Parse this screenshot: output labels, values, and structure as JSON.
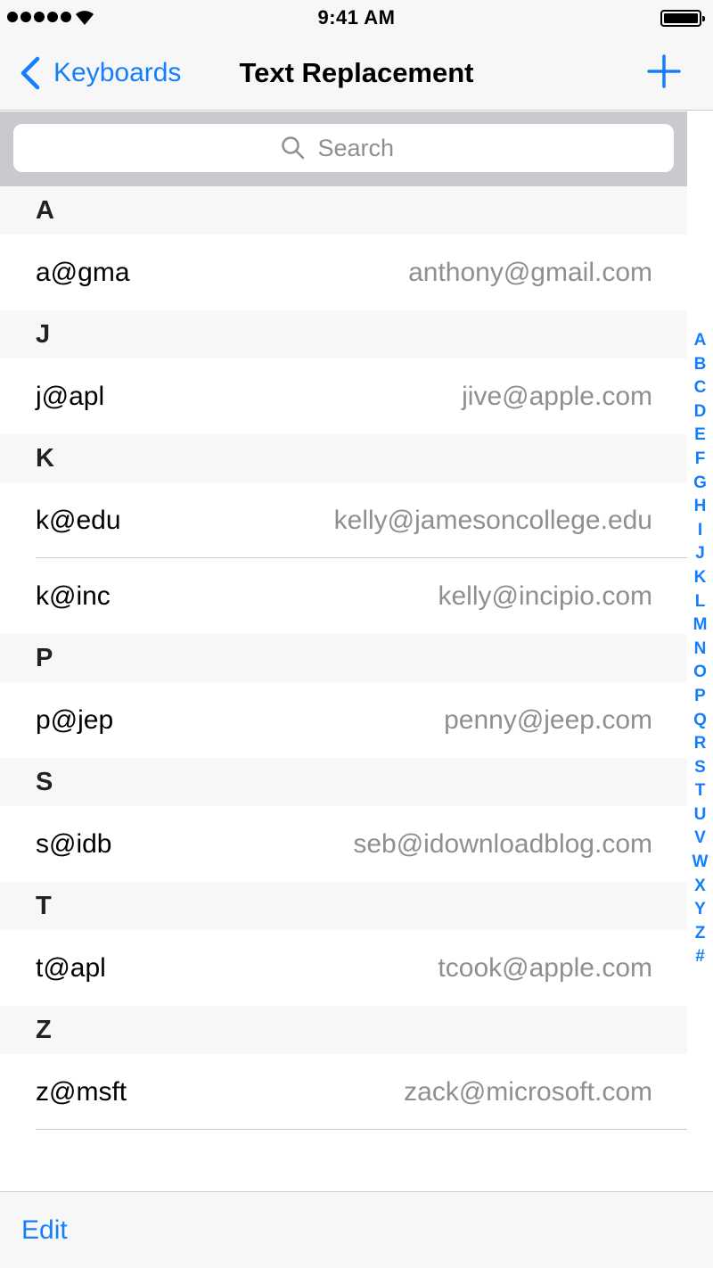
{
  "status_bar": {
    "time": "9:41 AM",
    "signal_icon": "signal-dots-icon",
    "wifi_icon": "wifi-icon",
    "battery_icon": "battery-full-icon"
  },
  "nav": {
    "back_label": "Keyboards",
    "back_icon": "chevron-left-icon",
    "title": "Text Replacement",
    "add_icon": "plus-icon"
  },
  "search": {
    "placeholder": "Search",
    "icon": "search-icon"
  },
  "sections": [
    {
      "letter": "A",
      "rows": [
        {
          "shortcut": "a@gma",
          "phrase": "anthony@gmail.com"
        }
      ]
    },
    {
      "letter": "J",
      "rows": [
        {
          "shortcut": "j@apl",
          "phrase": "jive@apple.com"
        }
      ]
    },
    {
      "letter": "K",
      "rows": [
        {
          "shortcut": "k@edu",
          "phrase": "kelly@jamesoncollege.edu"
        },
        {
          "shortcut": "k@inc",
          "phrase": "kelly@incipio.com"
        }
      ]
    },
    {
      "letter": "P",
      "rows": [
        {
          "shortcut": "p@jep",
          "phrase": "penny@jeep.com"
        }
      ]
    },
    {
      "letter": "S",
      "rows": [
        {
          "shortcut": "s@idb",
          "phrase": "seb@idownloadblog.com"
        }
      ]
    },
    {
      "letter": "T",
      "rows": [
        {
          "shortcut": "t@apl",
          "phrase": "tcook@apple.com"
        }
      ]
    },
    {
      "letter": "Z",
      "rows": [
        {
          "shortcut": "z@msft",
          "phrase": "zack@microsoft.com"
        }
      ]
    }
  ],
  "index_letters": [
    "A",
    "B",
    "C",
    "D",
    "E",
    "F",
    "G",
    "H",
    "I",
    "J",
    "K",
    "L",
    "M",
    "N",
    "O",
    "P",
    "Q",
    "R",
    "S",
    "T",
    "U",
    "V",
    "W",
    "X",
    "Y",
    "Z",
    "#"
  ],
  "toolbar": {
    "edit_label": "Edit"
  },
  "colors": {
    "accent": "#147efb",
    "secondary_text": "#8e8e93",
    "bar_background": "#f7f7f7",
    "search_background": "#c9c9ce"
  }
}
